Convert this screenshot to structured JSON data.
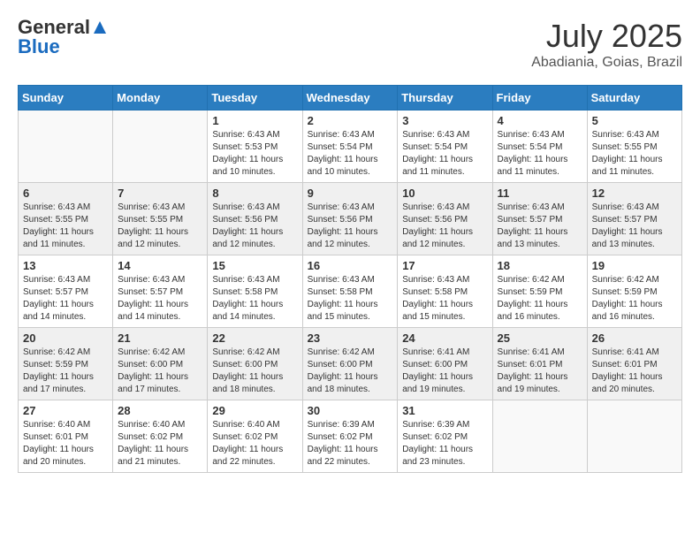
{
  "header": {
    "logo_general": "General",
    "logo_blue": "Blue",
    "title": "July 2025",
    "location": "Abadiania, Goias, Brazil"
  },
  "weekdays": [
    "Sunday",
    "Monday",
    "Tuesday",
    "Wednesday",
    "Thursday",
    "Friday",
    "Saturday"
  ],
  "weeks": [
    [
      {
        "day": "",
        "sunrise": "",
        "sunset": "",
        "daylight": ""
      },
      {
        "day": "",
        "sunrise": "",
        "sunset": "",
        "daylight": ""
      },
      {
        "day": "1",
        "sunrise": "Sunrise: 6:43 AM",
        "sunset": "Sunset: 5:53 PM",
        "daylight": "Daylight: 11 hours and 10 minutes."
      },
      {
        "day": "2",
        "sunrise": "Sunrise: 6:43 AM",
        "sunset": "Sunset: 5:54 PM",
        "daylight": "Daylight: 11 hours and 10 minutes."
      },
      {
        "day": "3",
        "sunrise": "Sunrise: 6:43 AM",
        "sunset": "Sunset: 5:54 PM",
        "daylight": "Daylight: 11 hours and 11 minutes."
      },
      {
        "day": "4",
        "sunrise": "Sunrise: 6:43 AM",
        "sunset": "Sunset: 5:54 PM",
        "daylight": "Daylight: 11 hours and 11 minutes."
      },
      {
        "day": "5",
        "sunrise": "Sunrise: 6:43 AM",
        "sunset": "Sunset: 5:55 PM",
        "daylight": "Daylight: 11 hours and 11 minutes."
      }
    ],
    [
      {
        "day": "6",
        "sunrise": "Sunrise: 6:43 AM",
        "sunset": "Sunset: 5:55 PM",
        "daylight": "Daylight: 11 hours and 11 minutes."
      },
      {
        "day": "7",
        "sunrise": "Sunrise: 6:43 AM",
        "sunset": "Sunset: 5:55 PM",
        "daylight": "Daylight: 11 hours and 12 minutes."
      },
      {
        "day": "8",
        "sunrise": "Sunrise: 6:43 AM",
        "sunset": "Sunset: 5:56 PM",
        "daylight": "Daylight: 11 hours and 12 minutes."
      },
      {
        "day": "9",
        "sunrise": "Sunrise: 6:43 AM",
        "sunset": "Sunset: 5:56 PM",
        "daylight": "Daylight: 11 hours and 12 minutes."
      },
      {
        "day": "10",
        "sunrise": "Sunrise: 6:43 AM",
        "sunset": "Sunset: 5:56 PM",
        "daylight": "Daylight: 11 hours and 12 minutes."
      },
      {
        "day": "11",
        "sunrise": "Sunrise: 6:43 AM",
        "sunset": "Sunset: 5:57 PM",
        "daylight": "Daylight: 11 hours and 13 minutes."
      },
      {
        "day": "12",
        "sunrise": "Sunrise: 6:43 AM",
        "sunset": "Sunset: 5:57 PM",
        "daylight": "Daylight: 11 hours and 13 minutes."
      }
    ],
    [
      {
        "day": "13",
        "sunrise": "Sunrise: 6:43 AM",
        "sunset": "Sunset: 5:57 PM",
        "daylight": "Daylight: 11 hours and 14 minutes."
      },
      {
        "day": "14",
        "sunrise": "Sunrise: 6:43 AM",
        "sunset": "Sunset: 5:57 PM",
        "daylight": "Daylight: 11 hours and 14 minutes."
      },
      {
        "day": "15",
        "sunrise": "Sunrise: 6:43 AM",
        "sunset": "Sunset: 5:58 PM",
        "daylight": "Daylight: 11 hours and 14 minutes."
      },
      {
        "day": "16",
        "sunrise": "Sunrise: 6:43 AM",
        "sunset": "Sunset: 5:58 PM",
        "daylight": "Daylight: 11 hours and 15 minutes."
      },
      {
        "day": "17",
        "sunrise": "Sunrise: 6:43 AM",
        "sunset": "Sunset: 5:58 PM",
        "daylight": "Daylight: 11 hours and 15 minutes."
      },
      {
        "day": "18",
        "sunrise": "Sunrise: 6:42 AM",
        "sunset": "Sunset: 5:59 PM",
        "daylight": "Daylight: 11 hours and 16 minutes."
      },
      {
        "day": "19",
        "sunrise": "Sunrise: 6:42 AM",
        "sunset": "Sunset: 5:59 PM",
        "daylight": "Daylight: 11 hours and 16 minutes."
      }
    ],
    [
      {
        "day": "20",
        "sunrise": "Sunrise: 6:42 AM",
        "sunset": "Sunset: 5:59 PM",
        "daylight": "Daylight: 11 hours and 17 minutes."
      },
      {
        "day": "21",
        "sunrise": "Sunrise: 6:42 AM",
        "sunset": "Sunset: 6:00 PM",
        "daylight": "Daylight: 11 hours and 17 minutes."
      },
      {
        "day": "22",
        "sunrise": "Sunrise: 6:42 AM",
        "sunset": "Sunset: 6:00 PM",
        "daylight": "Daylight: 11 hours and 18 minutes."
      },
      {
        "day": "23",
        "sunrise": "Sunrise: 6:42 AM",
        "sunset": "Sunset: 6:00 PM",
        "daylight": "Daylight: 11 hours and 18 minutes."
      },
      {
        "day": "24",
        "sunrise": "Sunrise: 6:41 AM",
        "sunset": "Sunset: 6:00 PM",
        "daylight": "Daylight: 11 hours and 19 minutes."
      },
      {
        "day": "25",
        "sunrise": "Sunrise: 6:41 AM",
        "sunset": "Sunset: 6:01 PM",
        "daylight": "Daylight: 11 hours and 19 minutes."
      },
      {
        "day": "26",
        "sunrise": "Sunrise: 6:41 AM",
        "sunset": "Sunset: 6:01 PM",
        "daylight": "Daylight: 11 hours and 20 minutes."
      }
    ],
    [
      {
        "day": "27",
        "sunrise": "Sunrise: 6:40 AM",
        "sunset": "Sunset: 6:01 PM",
        "daylight": "Daylight: 11 hours and 20 minutes."
      },
      {
        "day": "28",
        "sunrise": "Sunrise: 6:40 AM",
        "sunset": "Sunset: 6:02 PM",
        "daylight": "Daylight: 11 hours and 21 minutes."
      },
      {
        "day": "29",
        "sunrise": "Sunrise: 6:40 AM",
        "sunset": "Sunset: 6:02 PM",
        "daylight": "Daylight: 11 hours and 22 minutes."
      },
      {
        "day": "30",
        "sunrise": "Sunrise: 6:39 AM",
        "sunset": "Sunset: 6:02 PM",
        "daylight": "Daylight: 11 hours and 22 minutes."
      },
      {
        "day": "31",
        "sunrise": "Sunrise: 6:39 AM",
        "sunset": "Sunset: 6:02 PM",
        "daylight": "Daylight: 11 hours and 23 minutes."
      },
      {
        "day": "",
        "sunrise": "",
        "sunset": "",
        "daylight": ""
      },
      {
        "day": "",
        "sunrise": "",
        "sunset": "",
        "daylight": ""
      }
    ]
  ]
}
